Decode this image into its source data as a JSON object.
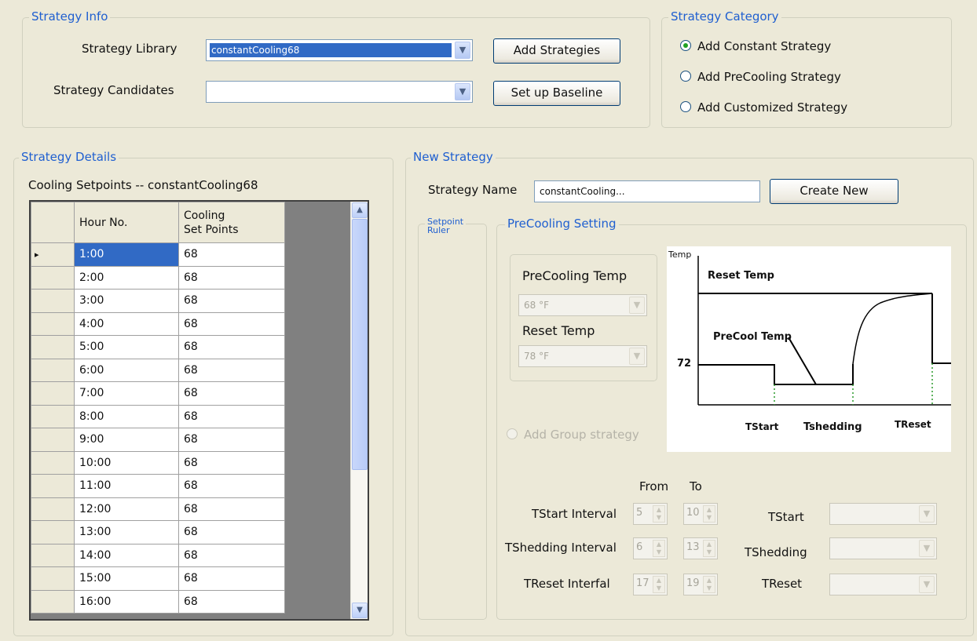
{
  "strategy_info": {
    "title": "Strategy Info",
    "library_label": "Strategy Library",
    "library_value": "constantCooling68",
    "candidates_label": "Strategy Candidates",
    "candidates_value": "",
    "add_strategies": "Add Strategies",
    "setup_baseline": "Set up Baseline"
  },
  "strategy_category": {
    "title": "Strategy Category",
    "options": [
      {
        "label": "Add Constant Strategy",
        "selected": true
      },
      {
        "label": "Add PreCooling Strategy",
        "selected": false
      },
      {
        "label": "Add Customized Strategy",
        "selected": false
      }
    ]
  },
  "strategy_details": {
    "title": "Strategy Details",
    "subtitle": "Cooling Setpoints -- constantCooling68",
    "columns": [
      "Hour No.",
      "Cooling\nSet Points"
    ],
    "rows": [
      {
        "hour": "1:00",
        "value": "68"
      },
      {
        "hour": "2:00",
        "value": "68"
      },
      {
        "hour": "3:00",
        "value": "68"
      },
      {
        "hour": "4:00",
        "value": "68"
      },
      {
        "hour": "5:00",
        "value": "68"
      },
      {
        "hour": "6:00",
        "value": "68"
      },
      {
        "hour": "7:00",
        "value": "68"
      },
      {
        "hour": "8:00",
        "value": "68"
      },
      {
        "hour": "9:00",
        "value": "68"
      },
      {
        "hour": "10:00",
        "value": "68"
      },
      {
        "hour": "11:00",
        "value": "68"
      },
      {
        "hour": "12:00",
        "value": "68"
      },
      {
        "hour": "13:00",
        "value": "68"
      },
      {
        "hour": "14:00",
        "value": "68"
      },
      {
        "hour": "15:00",
        "value": "68"
      },
      {
        "hour": "16:00",
        "value": "68"
      }
    ]
  },
  "new_strategy": {
    "title": "New Strategy",
    "name_label": "Strategy Name",
    "name_value": "constantCooling...",
    "create_new": "Create New",
    "setpoint_ruler": "Setpoint\nRuler",
    "precooling_setting": "PreCooling Setting",
    "precooling_temp_label": "PreCooling Temp",
    "precooling_temp_value": "68 °F",
    "reset_temp_label": "Reset Temp",
    "reset_temp_value": "78 °F",
    "add_group": "Add Group strategy",
    "diagram": {
      "temp": "Temp",
      "reset_temp": "Reset Temp",
      "precool_temp": "PreCool Temp",
      "tick_72": "72",
      "tstart": "TStart",
      "tshedding": "Tshedding",
      "treset": "TReset"
    },
    "from_label": "From",
    "to_label": "To",
    "intervals": [
      {
        "label": "TStart Interval",
        "from": "5",
        "to": "10",
        "name": "TStart"
      },
      {
        "label": "TShedding Interval",
        "from": "6",
        "to": "13",
        "name": "TShedding"
      },
      {
        "label": "TReset Interfal",
        "from": "17",
        "to": "19",
        "name": "TReset"
      }
    ]
  }
}
